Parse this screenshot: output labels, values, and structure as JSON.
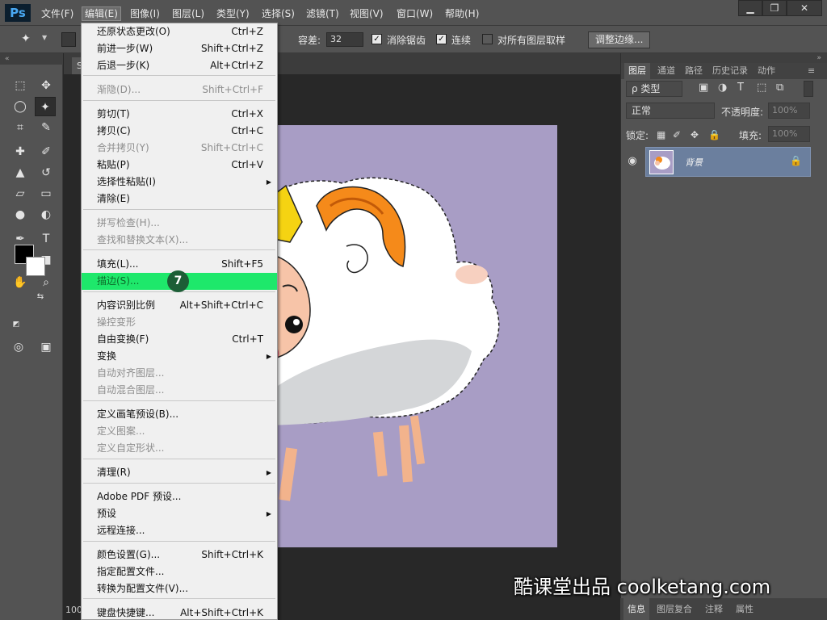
{
  "app": {
    "logo": "Ps",
    "menu": [
      {
        "label": "文件(F)"
      },
      {
        "label": "编辑(E)"
      },
      {
        "label": "图像(I)"
      },
      {
        "label": "图层(L)"
      },
      {
        "label": "类型(Y)"
      },
      {
        "label": "选择(S)"
      },
      {
        "label": "滤镜(T)"
      },
      {
        "label": "视图(V)"
      },
      {
        "label": "窗口(W)"
      },
      {
        "label": "帮助(H)"
      }
    ],
    "window_buttons": {
      "minimize": "▁",
      "maximize": "❐",
      "close": "✕"
    }
  },
  "options": {
    "tolerance_label": "容差:",
    "tolerance_value": "32",
    "antialias_label": "消除锯齿",
    "contiguous_label": "连续",
    "all_layers_label": "对所有图层取样",
    "refine_edge_label": "调整边缘..."
  },
  "document": {
    "tab_label": "Sh",
    "zoom": "100"
  },
  "edit_menu": [
    {
      "label": "还原状态更改(O)",
      "shortcut": "Ctrl+Z",
      "state": "enabled"
    },
    {
      "label": "前进一步(W)",
      "shortcut": "Shift+Ctrl+Z",
      "state": "enabled"
    },
    {
      "label": "后退一步(K)",
      "shortcut": "Alt+Ctrl+Z",
      "state": "enabled"
    },
    {
      "label": "渐隐(D)...",
      "shortcut": "Shift+Ctrl+F",
      "state": "disabled"
    },
    {
      "label": "剪切(T)",
      "shortcut": "Ctrl+X",
      "state": "enabled"
    },
    {
      "label": "拷贝(C)",
      "shortcut": "Ctrl+C",
      "state": "enabled"
    },
    {
      "label": "合并拷贝(Y)",
      "shortcut": "Shift+Ctrl+C",
      "state": "disabled"
    },
    {
      "label": "粘贴(P)",
      "shortcut": "Ctrl+V",
      "state": "enabled"
    },
    {
      "label": "选择性粘贴(I)",
      "shortcut": "",
      "state": "enabled",
      "submenu": true
    },
    {
      "label": "清除(E)",
      "shortcut": "",
      "state": "enabled"
    },
    {
      "label": "拼写检查(H)...",
      "shortcut": "",
      "state": "disabled"
    },
    {
      "label": "查找和替换文本(X)...",
      "shortcut": "",
      "state": "disabled"
    },
    {
      "label": "填充(L)...",
      "shortcut": "Shift+F5",
      "state": "enabled"
    },
    {
      "label": "描边(S)...",
      "shortcut": "",
      "state": "highlighted"
    },
    {
      "label": "内容识别比例",
      "shortcut": "Alt+Shift+Ctrl+C",
      "state": "enabled"
    },
    {
      "label": "操控变形",
      "shortcut": "",
      "state": "disabled"
    },
    {
      "label": "自由变换(F)",
      "shortcut": "Ctrl+T",
      "state": "enabled"
    },
    {
      "label": "变换",
      "shortcut": "",
      "state": "enabled",
      "submenu": true
    },
    {
      "label": "自动对齐图层...",
      "shortcut": "",
      "state": "disabled"
    },
    {
      "label": "自动混合图层...",
      "shortcut": "",
      "state": "disabled"
    },
    {
      "label": "定义画笔预设(B)...",
      "shortcut": "",
      "state": "enabled"
    },
    {
      "label": "定义图案...",
      "shortcut": "",
      "state": "disabled"
    },
    {
      "label": "定义自定形状...",
      "shortcut": "",
      "state": "disabled"
    },
    {
      "label": "清理(R)",
      "shortcut": "",
      "state": "enabled",
      "submenu": true
    },
    {
      "label": "Adobe PDF 预设...",
      "shortcut": "",
      "state": "enabled"
    },
    {
      "label": "预设",
      "shortcut": "",
      "state": "enabled",
      "submenu": true
    },
    {
      "label": "远程连接...",
      "shortcut": "",
      "state": "enabled"
    },
    {
      "label": "颜色设置(G)...",
      "shortcut": "Shift+Ctrl+K",
      "state": "enabled"
    },
    {
      "label": "指定配置文件...",
      "shortcut": "",
      "state": "enabled"
    },
    {
      "label": "转换为配置文件(V)...",
      "shortcut": "",
      "state": "enabled"
    },
    {
      "label": "键盘快捷键...",
      "shortcut": "Alt+Shift+Ctrl+K",
      "state": "enabled"
    }
  ],
  "step_badge": "7",
  "layers_panel": {
    "tabs": [
      {
        "label": "图层"
      },
      {
        "label": "通道"
      },
      {
        "label": "路径"
      },
      {
        "label": "历史记录"
      },
      {
        "label": "动作"
      }
    ],
    "filter_label": "ρ 类型",
    "blend_mode": "正常",
    "opacity_label": "不透明度:",
    "opacity_value": "100%",
    "lock_label": "锁定:",
    "fill_label": "填充:",
    "fill_value": "100%",
    "layer_name": "背景",
    "bottom_tabs": [
      {
        "label": "信息"
      },
      {
        "label": "图层复合"
      },
      {
        "label": "注释"
      },
      {
        "label": "属性"
      }
    ]
  },
  "watermark": "酷课堂出品 coolketang.com",
  "colors": {
    "canvas": "#a89dc5",
    "highlight": "#1ee86b",
    "ui": "#535353"
  }
}
